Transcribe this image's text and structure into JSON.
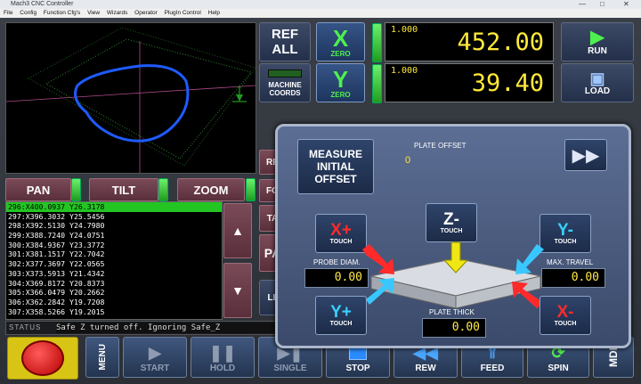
{
  "window": {
    "title": "Mach3 CNC Controller",
    "minimize": "—",
    "maximize": "□",
    "close": "✕"
  },
  "menu": [
    "File",
    "Config",
    "Function Cfg's",
    "View",
    "Wizards",
    "Operator",
    "PlugIn Control",
    "Help"
  ],
  "view_buttons": {
    "pan": "PAN",
    "tilt": "TILT",
    "zoom": "ZOOM"
  },
  "gcode_lines": [
    "296:X400.0937 Y26.3178",
    "297:X396.3032 Y25.5456",
    "298:X392.5130 Y24.7980",
    "299:X388.7240 Y24.0751",
    "300:X384.9367 Y23.3772",
    "301:X381.1517 Y22.7042",
    "302:X377.3697 Y22.0565",
    "303:X373.5913 Y21.4342",
    "304:X369.8172 Y20.8373",
    "305:X366.0479 Y20.2662",
    "306:X362.2842 Y19.7208",
    "307:X358.5266 Y19.2015"
  ],
  "status": {
    "label": "STATUS",
    "message": "Safe Z turned off. Ignoring Safe_Z"
  },
  "ref_all": {
    "line1": "REF",
    "line2": "ALL"
  },
  "machine_coords": {
    "line1": "MACHINE",
    "line2": "COORDS"
  },
  "axes": [
    {
      "letter": "X",
      "zero": "ZERO",
      "scale": "1.000",
      "value": "452.00"
    },
    {
      "letter": "Y",
      "zero": "ZERO",
      "scale": "1.000",
      "value": "39.40"
    }
  ],
  "run_label": "RUN",
  "load_label": "LOAD",
  "left_partial_labels": [
    "RE",
    "FO",
    "TA",
    "PA",
    "LI"
  ],
  "bottom": {
    "menu": "MENU",
    "start": "START",
    "hold": "HOLD",
    "single": "SINGLE",
    "stop": "STOP",
    "rew": "REW",
    "feed": "FEED",
    "spin": "SPIN",
    "mdi": "MDI"
  },
  "dialog": {
    "measure_line1": "MEASURE",
    "measure_line2": "INITIAL",
    "measure_line3": "OFFSET",
    "plate_offset_label": "PLATE OFFSET",
    "plate_offset_value": "0",
    "xplus": "X+",
    "zminus": "Z-",
    "yminus": "Y-",
    "yplus": "Y+",
    "xminus": "X-",
    "touch": "TOUCH",
    "probe_diam_label": "PROBE DIAM.",
    "probe_diam_value": "0.00",
    "max_travel_label": "MAX. TRAVEL",
    "max_travel_value": "0.00",
    "plate_thick_label": "PLATE THICK",
    "plate_thick_value": "0.00"
  }
}
